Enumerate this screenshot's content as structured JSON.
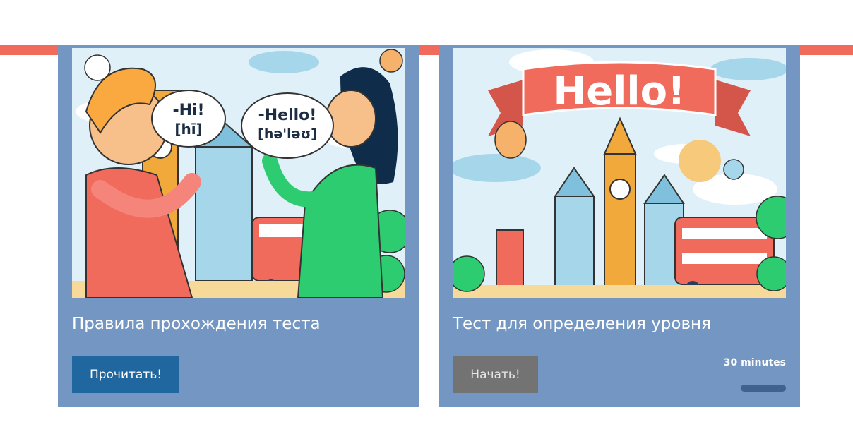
{
  "colors": {
    "accent_band": "#f06b5c",
    "card_bg": "#7397c2",
    "read_button": "#21679f",
    "start_button": "#737373",
    "progress_track": "#3e6391"
  },
  "cards": [
    {
      "title": "Правила прохождения теста",
      "button_label": "Прочитать!",
      "illustration": {
        "speech_left_line1": "-Hi!",
        "speech_left_line2": "[hī]",
        "speech_right_line1": "-Hello!",
        "speech_right_line2": "[hə'ləʊ]"
      }
    },
    {
      "title": "Тест для определения уровня",
      "button_label": "Начать!",
      "duration": "30 minutes",
      "progress": 0,
      "illustration": {
        "banner_text": "Hello!"
      }
    }
  ]
}
